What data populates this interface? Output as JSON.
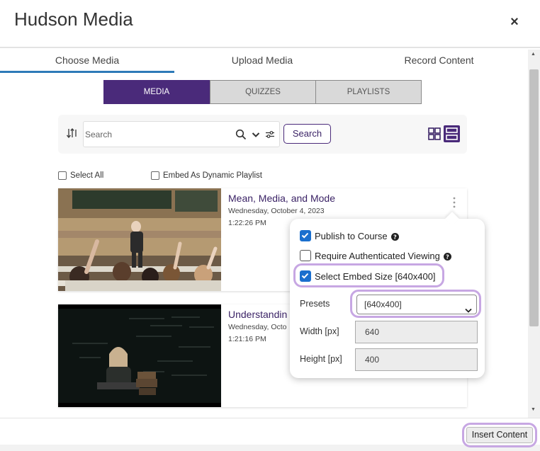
{
  "dialog": {
    "title": "Hudson Media",
    "close_label": "×"
  },
  "main_tabs": [
    {
      "label": "Choose Media",
      "active": true
    },
    {
      "label": "Upload Media",
      "active": false
    },
    {
      "label": "Record Content",
      "active": false
    }
  ],
  "sub_tabs": [
    {
      "label": "MEDIA",
      "active": true
    },
    {
      "label": "QUIZZES",
      "active": false
    },
    {
      "label": "PLAYLISTS",
      "active": false
    }
  ],
  "search": {
    "placeholder": "Search",
    "value": "",
    "button_label": "Search",
    "view_mode": "list"
  },
  "options": {
    "select_all_label": "Select All",
    "dynamic_playlist_label": "Embed As Dynamic Playlist"
  },
  "media_items": [
    {
      "title": "Mean, Media, and Mode",
      "date": "Wednesday, October 4, 2023",
      "time": "1:22:26 PM"
    },
    {
      "title": "Understandin",
      "date": "Wednesday, Octo",
      "time": "1:21:16 PM"
    }
  ],
  "embed_popover": {
    "publish_label": "Publish to Course",
    "publish_checked": true,
    "auth_label": "Require Authenticated Viewing",
    "auth_checked": false,
    "embed_size_label": "Select Embed Size [640x400]",
    "embed_size_checked": true,
    "presets_label": "Presets",
    "presets_value": "[640x400]",
    "width_label": "Width [px]",
    "width_value": "640",
    "height_label": "Height [px]",
    "height_value": "400"
  },
  "footer": {
    "insert_label": "Insert Content"
  },
  "colors": {
    "brand_purple": "#4a2a7a",
    "highlight_lilac": "#c7a7e3",
    "tab_underline": "#2e7ab8",
    "checkbox_blue": "#1a6fce"
  }
}
